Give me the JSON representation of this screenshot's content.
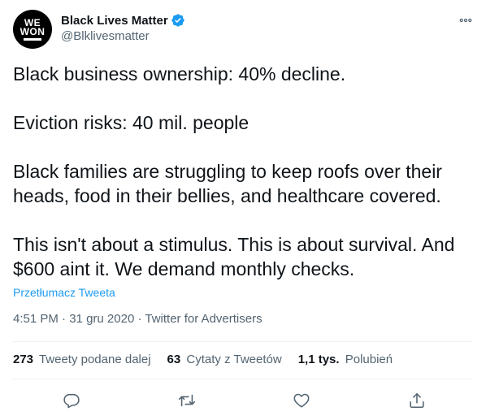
{
  "author": {
    "display_name": "Black Lives Matter",
    "handle": "@Blklivesmatter",
    "avatar_text_line1": "WE",
    "avatar_text_line2": "WON",
    "verified": true
  },
  "tweet": {
    "paragraphs": [
      "Black business ownership: 40% decline.",
      "Eviction risks: 40 mil. people",
      "Black families are struggling to keep roofs over their heads, food in their bellies, and healthcare covered.",
      "This isn't about a stimulus. This is about survival. And $600 aint it. We demand monthly checks."
    ],
    "translate_label": "Przetłumacz Tweeta",
    "time": "4:51 PM",
    "date": "31 gru 2020",
    "source": "Twitter for Advertisers",
    "separator": "·"
  },
  "stats": {
    "retweets_count": "273",
    "retweets_label": "Tweety podane dalej",
    "quotes_count": "63",
    "quotes_label": "Cytaty z Tweetów",
    "likes_count": "1,1 tys.",
    "likes_label": "Polubień"
  },
  "colors": {
    "accent": "#1d9bf0",
    "text_primary": "#0f1419",
    "text_secondary": "#536471",
    "divider": "#eff3f4"
  },
  "icons": {
    "verified": "verified-badge-icon",
    "more": "more-options-icon",
    "reply": "reply-icon",
    "retweet": "retweet-icon",
    "like": "like-icon",
    "share": "share-icon"
  }
}
